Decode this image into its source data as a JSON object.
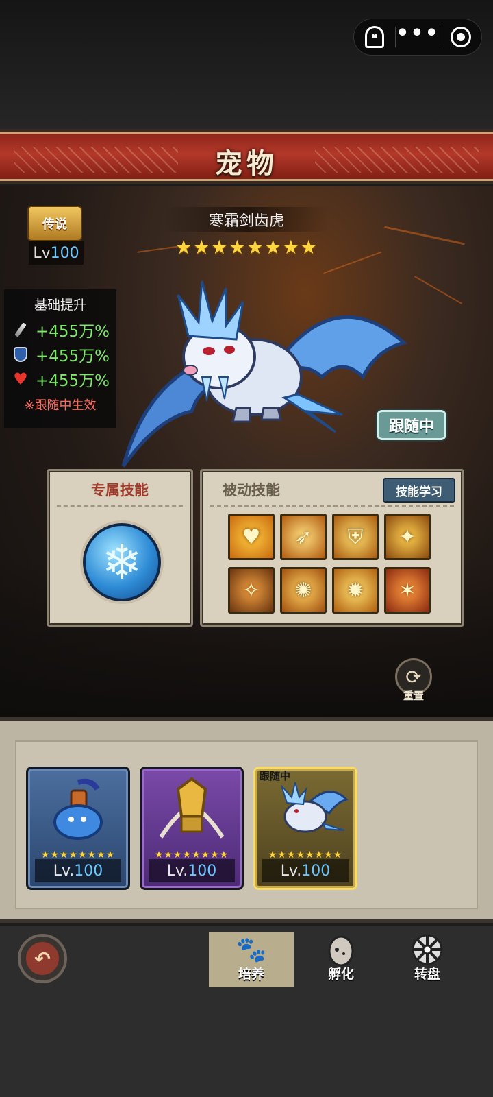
{
  "header": {
    "title": "宠物",
    "capsule_icons": [
      "ghost-icon",
      "more-dots-icon",
      "record-target-icon"
    ]
  },
  "pet": {
    "rarity_label": "传说",
    "level_prefix": "Lv",
    "level_value": "100",
    "name": "寒霜剑齿虎",
    "stars": "★★★★★★★★",
    "status_badge": "跟随中"
  },
  "stats": {
    "title": "基础提升",
    "items": [
      {
        "icon": "sword-icon",
        "value": "+455万%"
      },
      {
        "icon": "shield-icon",
        "value": "+455万%"
      },
      {
        "icon": "heart-icon",
        "value": "+455万%"
      }
    ],
    "note": "※跟随中生效"
  },
  "skills": {
    "exclusive_title": "专属技能",
    "exclusive_icon": "snowflake-icon",
    "passive_title": "被动技能",
    "learn_button": "技能学习",
    "passive_icons": [
      "heart-skill-icon",
      "spear-skill-icon",
      "shield-skill-icon",
      "dragon-wing-skill-icon",
      "warrior-skill-icon",
      "book-skill-icon",
      "claw-skill-icon",
      "fire-figure-skill-icon"
    ]
  },
  "reset_label": "重置",
  "roster": {
    "cards": [
      {
        "stars": "★★★★★★★★",
        "level_prefix": "Lv.",
        "level_value": "100"
      },
      {
        "stars": "★★★★★★★★",
        "level_prefix": "Lv.",
        "level_value": "100"
      },
      {
        "stars": "★★★★★★★★",
        "level_prefix": "Lv.",
        "level_value": "100",
        "tag": "跟随中"
      }
    ]
  },
  "nav": {
    "tabs": [
      {
        "label": "培养",
        "icon": "paw-icon"
      },
      {
        "label": "孵化",
        "icon": "egg-icon"
      },
      {
        "label": "转盘",
        "icon": "wheel-icon"
      }
    ]
  }
}
